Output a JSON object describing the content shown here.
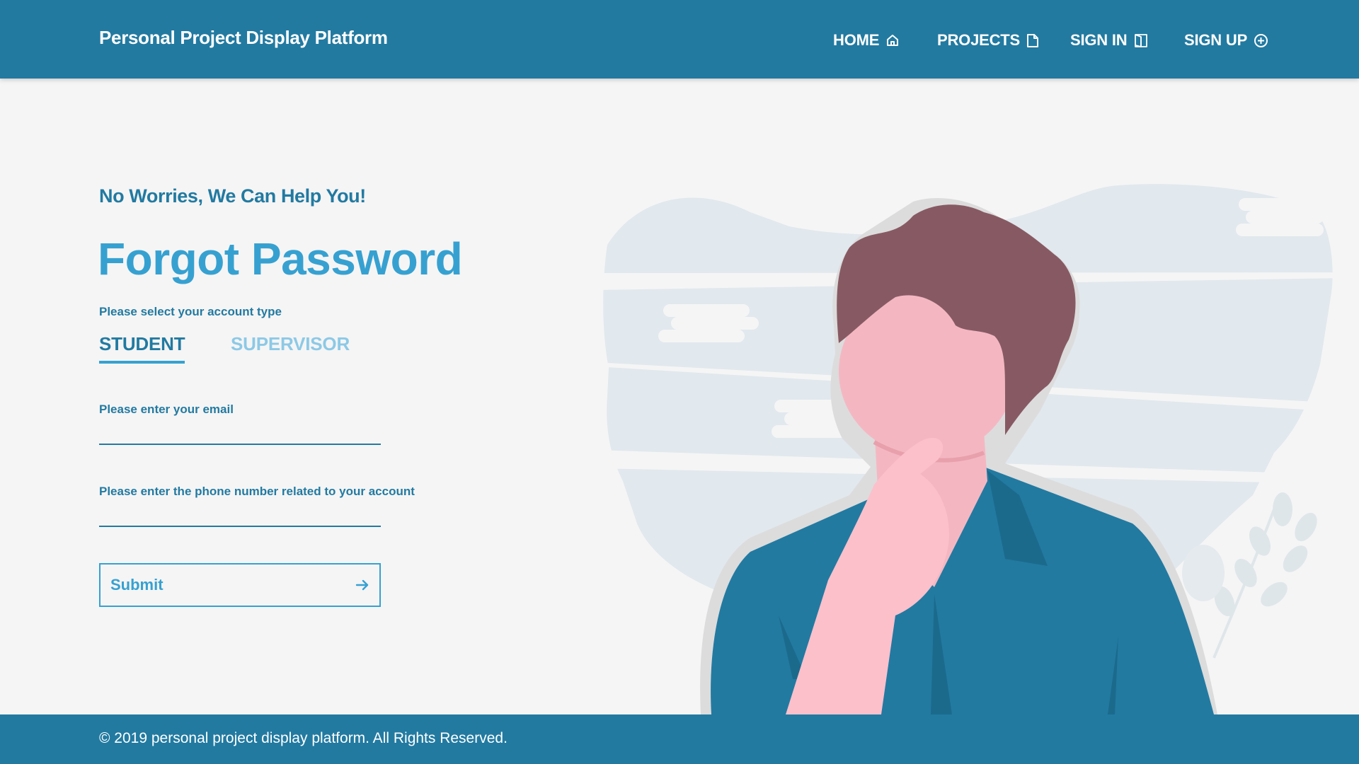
{
  "header": {
    "brand": "Personal Project Display Platform",
    "nav": [
      {
        "label": "HOME",
        "icon": "home-icon"
      },
      {
        "label": "PROJECTS",
        "icon": "file-icon"
      },
      {
        "label": "SIGN IN",
        "icon": "door-icon"
      },
      {
        "label": "SIGN UP",
        "icon": "plus-circle-icon"
      }
    ]
  },
  "form": {
    "subtitle": "No Worries, We Can Help You!",
    "title": "Forgot Password",
    "account_type_label": "Please select your account type",
    "tabs": [
      {
        "label": "STUDENT",
        "active": true
      },
      {
        "label": "SUPERVISOR",
        "active": false
      }
    ],
    "email_label": "Please enter your email",
    "email_value": "",
    "phone_label": "Please enter the phone number related to your account",
    "phone_value": "",
    "submit_label": "Submit"
  },
  "footer": {
    "copyright": "© 2019 personal project display platform. All Rights Reserved."
  },
  "colors": {
    "primary": "#227aa1",
    "accent": "#36a1d1",
    "inactive_tab": "#8cc9e6",
    "background": "#f5f5f5"
  }
}
